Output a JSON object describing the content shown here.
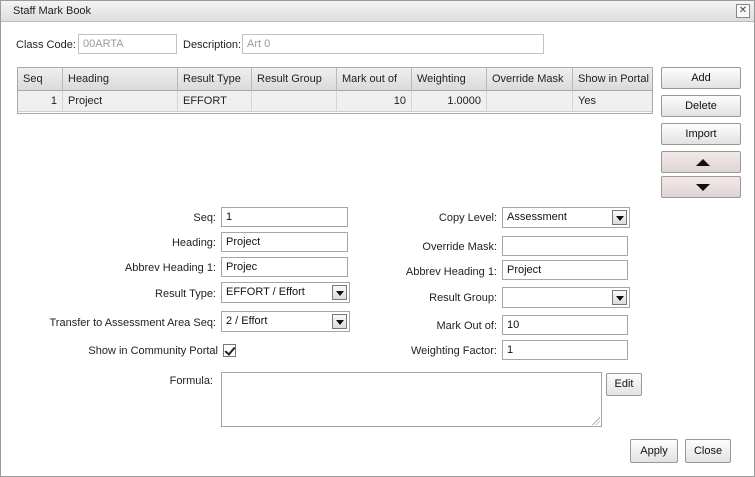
{
  "window": {
    "title": "Staff Mark Book",
    "close_icon": "close-icon"
  },
  "class_code": {
    "label": "Class Code:",
    "value": "00ARTA"
  },
  "description": {
    "label": "Description:",
    "value": "Art 0"
  },
  "grid": {
    "columns": [
      "Seq",
      "Heading",
      "Result Type",
      "Result Group",
      "Mark out of",
      "Weighting",
      "Override Mask",
      "Show in Portal"
    ],
    "rows": [
      {
        "seq": "1",
        "heading": "Project",
        "result_type": "EFFORT",
        "result_group": "",
        "mark_out_of": "10",
        "weighting": "1.0000",
        "override_mask": "",
        "show_in_portal": "Yes"
      }
    ]
  },
  "side_buttons": {
    "add": "Add",
    "delete": "Delete",
    "import": "Import",
    "up_icon": "triangle-up-icon",
    "down_icon": "triangle-down-icon"
  },
  "form": {
    "seq": {
      "label": "Seq:",
      "value": "1"
    },
    "heading": {
      "label": "Heading:",
      "value": "Project"
    },
    "abbrev_heading_1": {
      "label": "Abbrev Heading 1:",
      "value": "Projec"
    },
    "result_type": {
      "label": "Result Type:",
      "value": "EFFORT / Effort"
    },
    "transfer_seq": {
      "label": "Transfer to Assessment Area Seq:",
      "value": "2 / Effort"
    },
    "show_in_portal": {
      "label": "Show in Community Portal",
      "checked": true
    },
    "formula": {
      "label": "Formula:",
      "value": ""
    },
    "copy_level": {
      "label": "Copy Level:",
      "value": "Assessment"
    },
    "override_mask": {
      "label": "Override Mask:",
      "value": ""
    },
    "abbrev_heading_1_right": {
      "label": "Abbrev Heading 1:",
      "value": "Project"
    },
    "result_group": {
      "label": "Result Group:",
      "value": ""
    },
    "mark_out_of": {
      "label": "Mark Out of:",
      "value": "10"
    },
    "weighting_factor": {
      "label": "Weighting Factor:",
      "value": "1"
    }
  },
  "buttons": {
    "edit": "Edit",
    "apply": "Apply",
    "close": "Close"
  }
}
